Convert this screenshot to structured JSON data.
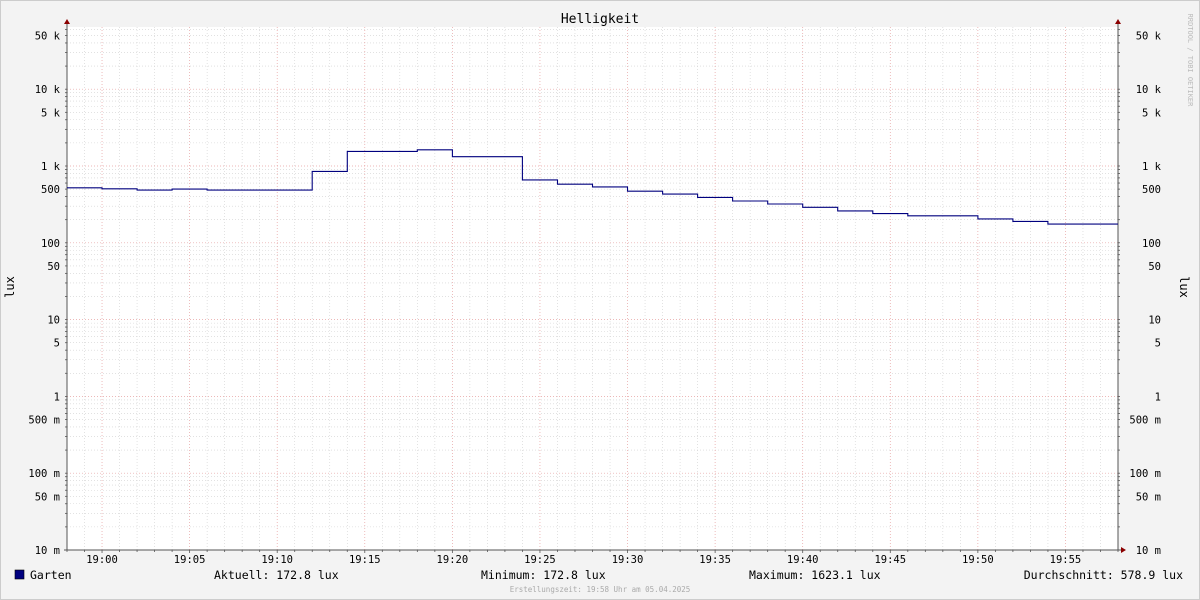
{
  "chart_data": {
    "type": "line",
    "title": "Helligkeit",
    "ylabel_left": "lux",
    "ylabel_right": "lux",
    "watermark": "RRDTOOL / TOBI OETIKER",
    "y_scale": "log",
    "ylim": [
      0.01,
      80000
    ],
    "xlim": [
      "18:58",
      "19:58"
    ],
    "grid": true,
    "legend_position": "bottom-left",
    "y_ticks": [
      {
        "value": 50000,
        "label": "50 k"
      },
      {
        "value": 10000,
        "label": "10 k"
      },
      {
        "value": 5000,
        "label": "5 k"
      },
      {
        "value": 1000,
        "label": "1 k"
      },
      {
        "value": 500,
        "label": "500"
      },
      {
        "value": 100,
        "label": "100"
      },
      {
        "value": 50,
        "label": "50"
      },
      {
        "value": 10,
        "label": "10"
      },
      {
        "value": 5,
        "label": "5"
      },
      {
        "value": 1,
        "label": "1"
      },
      {
        "value": 0.5,
        "label": "500 m"
      },
      {
        "value": 0.1,
        "label": "100 m"
      },
      {
        "value": 0.05,
        "label": "50 m"
      },
      {
        "value": 0.01,
        "label": "10 m"
      }
    ],
    "x_ticks": [
      "19:00",
      "19:05",
      "19:10",
      "19:15",
      "19:20",
      "19:25",
      "19:30",
      "19:35",
      "19:40",
      "19:45",
      "19:50",
      "19:55"
    ],
    "series": [
      {
        "name": "Garten",
        "color": "#00007f",
        "points": [
          [
            "18:58",
            520
          ],
          [
            "19:00",
            505
          ],
          [
            "19:02",
            485
          ],
          [
            "19:04",
            500
          ],
          [
            "19:06",
            485
          ],
          [
            "19:12",
            850
          ],
          [
            "19:14",
            1550
          ],
          [
            "19:18",
            1623.1
          ],
          [
            "19:20",
            1320
          ],
          [
            "19:24",
            660
          ],
          [
            "19:26",
            580
          ],
          [
            "19:28",
            535
          ],
          [
            "19:30",
            470
          ],
          [
            "19:32",
            430
          ],
          [
            "19:34",
            390
          ],
          [
            "19:36",
            350
          ],
          [
            "19:38",
            320
          ],
          [
            "19:40",
            290
          ],
          [
            "19:42",
            260
          ],
          [
            "19:44",
            240
          ],
          [
            "19:46",
            225
          ],
          [
            "19:50",
            205
          ],
          [
            "19:52",
            190
          ],
          [
            "19:54",
            175
          ],
          [
            "19:58",
            172.8
          ]
        ]
      }
    ]
  },
  "legend": {
    "series_name": "Garten",
    "series_color": "#00007f",
    "current": "Aktuell: 172.8 lux",
    "minimum": "Minimum: 172.8 lux",
    "maximum": "Maximum: 1623.1 lux",
    "average": "Durchschnitt: 578.9 lux"
  },
  "footer": "Erstellungszeit: 19:58 Uhr am 05.04.2025",
  "colors": {
    "frame_bg": "#f3f3f3",
    "canvas_bg": "#ffffff",
    "major_grid": "#e6a0a0",
    "minor_grid": "#d0d0d0",
    "axis": "#555555",
    "arrow": "#8b0000",
    "text": "#000000",
    "watermark": "#bbbbbb",
    "footer_text": "#aaaaaa"
  }
}
